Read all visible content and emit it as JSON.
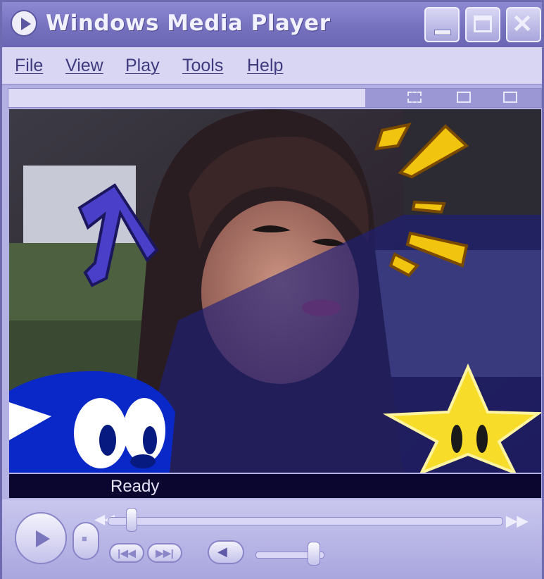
{
  "window": {
    "title": "Windows Media Player"
  },
  "title_buttons": {
    "minimize": "minimize-button",
    "maximize": "maximize-button",
    "close": "✕"
  },
  "menu": [
    "File",
    "View",
    "Play",
    "Tools",
    "Help"
  ],
  "status": {
    "text": "Ready"
  },
  "playback": {
    "seek_fraction": 0.05,
    "volume_fraction": 0.8
  },
  "controls": {
    "prev_glyph": "|◀◀",
    "next_glyph": "▶▶|",
    "rewind_glyph": "◀◀",
    "forward_glyph": "▶▶"
  },
  "colors": {
    "title_bar": "#7470bd",
    "window": "#b3b0e4",
    "status_bg": "#0a0630",
    "accent": "#5b57a0"
  }
}
